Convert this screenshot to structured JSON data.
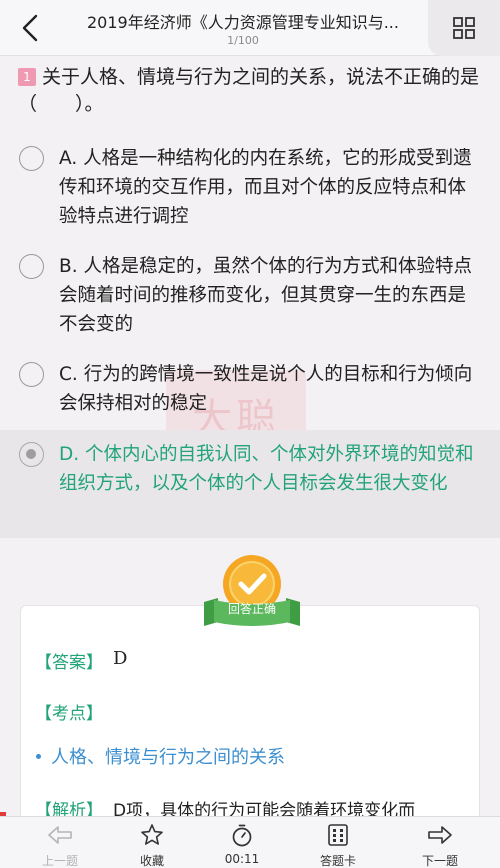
{
  "header": {
    "title": "2019年经济师《人力资源管理专业知识与...",
    "progress": "1/100",
    "back_icon": "chevron-left-icon",
    "menu_icon": "grid-icon"
  },
  "question": {
    "number": "1",
    "text": "关于人格、情境与行为之间的关系，说法不正确的是（　　）。"
  },
  "options": [
    {
      "letter": "A.",
      "text": "人格是一种结构化的内在系统，它的形成受到遗传和环境的交互作用，而且对个体的反应特点和体验特点进行调控",
      "selected": false
    },
    {
      "letter": "B.",
      "text": "人格是稳定的，虽然个体的行为方式和体验特点会随着时间的推移而变化，但其贯穿一生的东西是不会变的",
      "selected": false
    },
    {
      "letter": "C.",
      "text": "行为的跨情境一致性是说个人的目标和行为倾向会保持相对的稳定",
      "selected": false
    },
    {
      "letter": "D.",
      "text": "个体内心的自我认同、个体对外界环境的知觉和组织方式，以及个体的个人目标会发生很大变化",
      "selected": true
    }
  ],
  "watermark": "大聪",
  "result_badge": "回答正确",
  "analysis": {
    "answer_label": "【答案】",
    "answer_value": "D",
    "point_label": "【考点】",
    "point_item": "人格、情境与行为之间的关系",
    "explain_label": "【解析】",
    "explain_text": "D项，具体的行为可能会随着环境变化而"
  },
  "bottom_bar": {
    "prev": "上一题",
    "favorite": "收藏",
    "timer": "00:11",
    "answer_card": "答题卡",
    "next": "下一题"
  },
  "colors": {
    "accent_green": "#22a37a",
    "link_blue": "#3d8fcf",
    "number_badge": "#ef9ab2",
    "badge_orange": "#f5a623",
    "badge_ribbon": "#5cb85c"
  }
}
